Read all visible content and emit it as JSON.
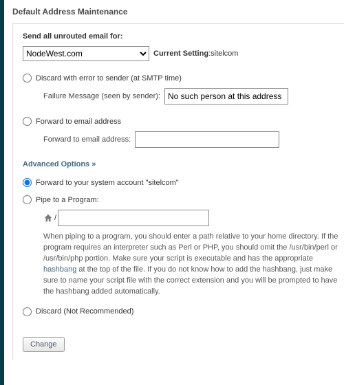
{
  "title": "Default Address Maintenance",
  "section_label": "Send all unrouted email for:",
  "domain_selected": "NodeWest.com",
  "current_setting": {
    "label": "Current Setting",
    "value": "sitelcom"
  },
  "options": {
    "discard_error": {
      "label": "Discard with error to sender (at SMTP time)",
      "failure_label": "Failure Message (seen by sender):",
      "failure_value": "No such person at this address"
    },
    "forward_addr": {
      "label": "Forward to email address",
      "sub_label": "Forward to email address:",
      "value": ""
    },
    "advanced_title": "Advanced Options »",
    "forward_sys": {
      "label": "Forward to your system account \"sitelcom\""
    },
    "pipe": {
      "label": "Pipe to a Program:",
      "value": "",
      "note_pre": "When piping to a program, you should enter a path relative to your home directory. If the program requires an interpreter such as Perl or PHP, you should omit the /usr/bin/perl or /usr/bin/php portion. Make sure your script is executable and has the appropriate ",
      "note_link": "hashbang",
      "note_post": " at the top of the file. If you do not know how to add the hashbang, just make sure to name your script file with the correct extension and you will be prompted to have the hashbang added automatically."
    },
    "discard_nr": {
      "label": "Discard (Not Recommended)"
    }
  },
  "selected_option": "forward_sys",
  "change_button": "Change",
  "icons": {
    "home": "home-icon"
  }
}
